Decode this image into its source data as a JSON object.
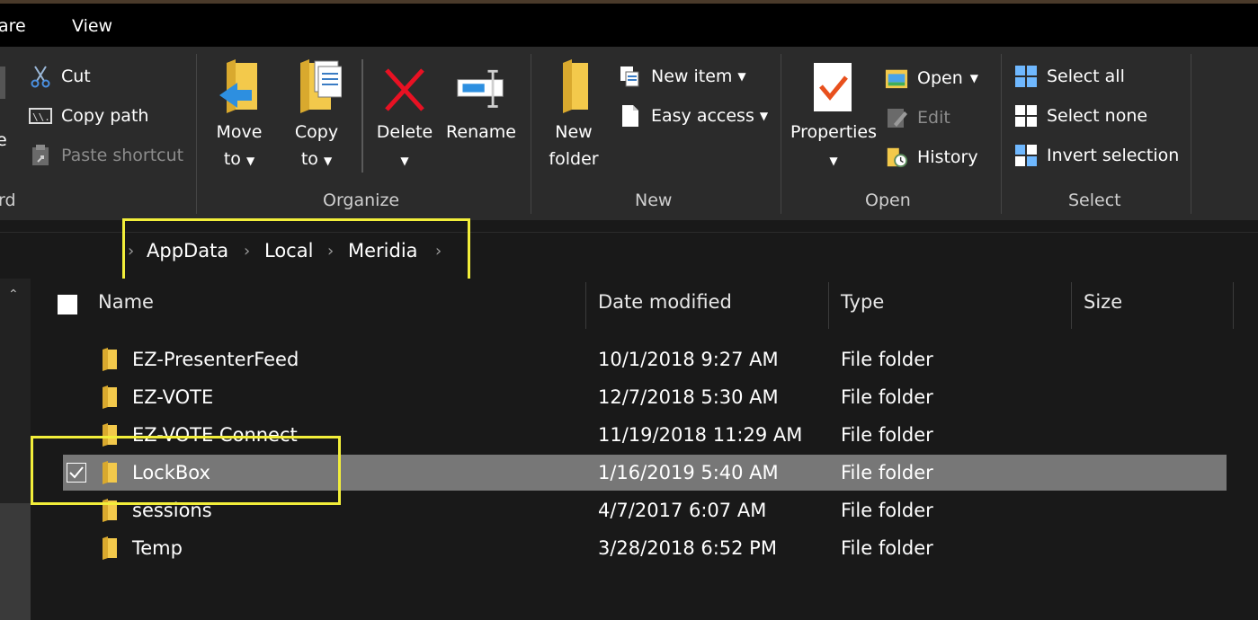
{
  "menubar": {
    "tabs": [
      "are",
      "View"
    ]
  },
  "ribbon": {
    "clipboard": {
      "label_partial": "rd",
      "cut": "Cut",
      "copy_path": "Copy path",
      "paste_shortcut": "Paste shortcut",
      "left_partial": "e"
    },
    "organize": {
      "label": "Organize",
      "move_to": [
        "Move",
        "to"
      ],
      "copy_to": [
        "Copy",
        "to"
      ],
      "delete": "Delete",
      "rename": "Rename"
    },
    "new": {
      "label": "New",
      "new_folder": [
        "New",
        "folder"
      ],
      "new_item": "New item",
      "easy_access": "Easy access"
    },
    "open": {
      "label": "Open",
      "properties": "Properties",
      "open": "Open",
      "edit": "Edit",
      "history": "History"
    },
    "select": {
      "label": "Select",
      "select_all": "Select all",
      "select_none": "Select none",
      "invert_selection": "Invert selection"
    }
  },
  "breadcrumb": [
    "AppData",
    "Local",
    "Meridia"
  ],
  "columns": {
    "name": "Name",
    "date": "Date modified",
    "type": "Type",
    "size": "Size"
  },
  "files": [
    {
      "name": "EZ-PresenterFeed",
      "date": "10/1/2018 9:27 AM",
      "type": "File folder"
    },
    {
      "name": "EZ-VOTE",
      "date": "12/7/2018 5:30 AM",
      "type": "File folder"
    },
    {
      "name": "EZ-VOTE Connect",
      "date": "11/19/2018 11:29 AM",
      "type": "File folder"
    },
    {
      "name": "LockBox",
      "date": "1/16/2019 5:40 AM",
      "type": "File folder",
      "selected": true
    },
    {
      "name": "sessions",
      "date": "4/7/2017 6:07 AM",
      "type": "File folder"
    },
    {
      "name": "Temp",
      "date": "3/28/2018 6:52 PM",
      "type": "File folder"
    }
  ],
  "colors": {
    "highlight": "#f2ee3a",
    "selected_row": "#777777",
    "background": "#191919",
    "ribbon": "#2b2b2b"
  }
}
